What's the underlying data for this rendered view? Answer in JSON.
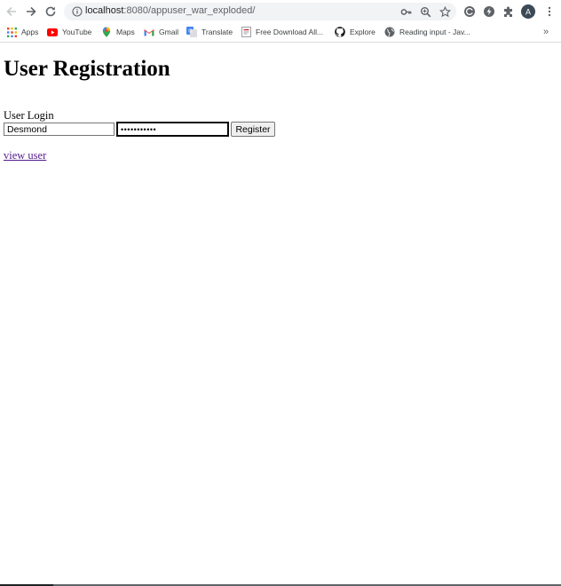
{
  "browser": {
    "url_host": "localhost",
    "url_path": ":8080/appuser_war_exploded/",
    "icons": {
      "back": "arrow-left-icon",
      "forward": "arrow-right-icon",
      "reload": "reload-icon",
      "site_info": "info-icon",
      "password_key": "key-icon",
      "zoom": "zoom-icon",
      "bookmark_star": "star-icon",
      "extension_1": "extension-c-icon",
      "extension_2": "extension-bolt-icon",
      "extensions": "puzzle-icon",
      "profile": "avatar",
      "menu": "kebab-menu-icon"
    },
    "profile_initial": "A",
    "accent_color": "#5f6368",
    "omnibox_color": "#f1f3f4"
  },
  "bookmarks": {
    "items": [
      {
        "label": "Apps",
        "icon": "apps-grid-icon"
      },
      {
        "label": "YouTube",
        "icon": "youtube-icon"
      },
      {
        "label": "Maps",
        "icon": "maps-icon"
      },
      {
        "label": "Gmail",
        "icon": "gmail-icon"
      },
      {
        "label": "Translate",
        "icon": "translate-icon"
      },
      {
        "label": "Free Download All...",
        "icon": "page-icon"
      },
      {
        "label": "Explore",
        "icon": "github-icon"
      },
      {
        "label": "Reading input - Jav...",
        "icon": "globe-icon"
      }
    ],
    "overflow": "»"
  },
  "page": {
    "title": "User Registration",
    "login_label": "User Login",
    "username_value": "Desmond",
    "password_value": "•••••••••••",
    "register_label": "Register",
    "view_link": "view user",
    "link_color": "#551a8b"
  }
}
